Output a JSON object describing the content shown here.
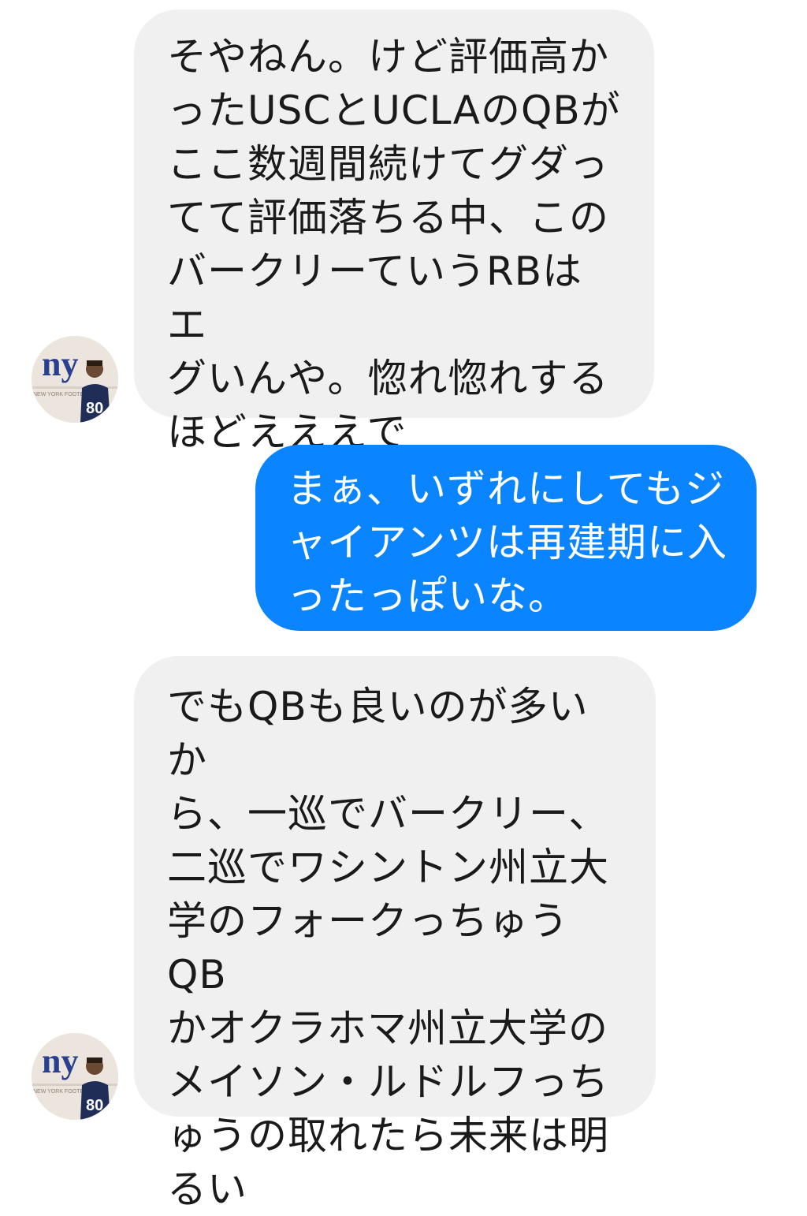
{
  "conversation": {
    "messages": [
      {
        "sender": "other",
        "text": "そやねん。けど評価高か\nったUSCとUCLAのQBが\nここ数週間続けてグダっ\nてて評価落ちる中、この\nバークリーていうRBはエ\nグいんや。惚れ惚れする\nほどえええで"
      },
      {
        "sender": "me",
        "text": "まぁ、いずれにしてもジ\nャイアンツは再建期に入\nったっぽいな。"
      },
      {
        "sender": "other",
        "text": "でもQBも良いのが多いか\nら、一巡でバークリー、\n二巡でワシントン州立大\n学のフォークっちゅうQB\nかオクラホマ州立大学の\nメイソン・ルドルフっち\nゅうの取れたら未来は明\nるい"
      }
    ],
    "avatar": {
      "icon": "profile-photo-icon",
      "logo_text": "ny",
      "shirt_number": "80",
      "wall_text": "NEW YORK FOOTBALL"
    },
    "colors": {
      "incoming_bubble": "#f0f0f0",
      "outgoing_bubble": "#0a84ff",
      "incoming_text": "#1a1a1a",
      "outgoing_text": "#ffffff",
      "logo": "#2b3f8f"
    }
  }
}
